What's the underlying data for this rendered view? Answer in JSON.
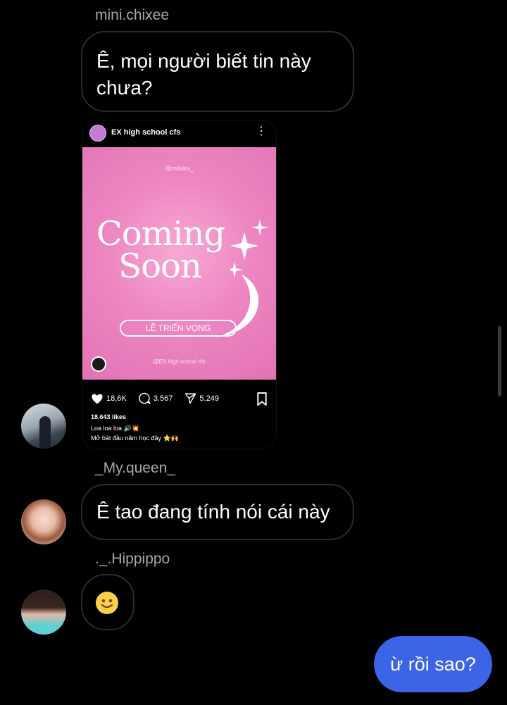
{
  "messages": [
    {
      "sender": "mini.chixee",
      "text": "Ê, mọi người biết tin này chưa?"
    },
    {
      "sender": "_My.queen_",
      "text": "Ê tao đang tính nói cái này"
    },
    {
      "sender": "._.Hippippo",
      "emoji": "slightly-smiling-face"
    }
  ],
  "shared_post": {
    "account": "EX high school cfs",
    "top_watermark": "@miluka_",
    "headline_line1": "Coming",
    "headline_line2": "Soon",
    "event_label": "LỄ TRIỂN VỌNG",
    "bottom_watermark": "@EX high school cfs",
    "likes_count": "18,6K",
    "comments_count": "3.567",
    "shares_count": "5.249",
    "likes_text": "18.643 likes",
    "caption_line1": "Loa loa loa 🔊💥",
    "caption_line2": "Mở bát đầu năm học đây ⭐🙌",
    "image_colors": {
      "light": "#f7a9d4",
      "mid": "#ee86c2",
      "dark": "#e173b5"
    }
  },
  "my_reply": {
    "text": "ừ rồi sao?",
    "color": "#3b64e6"
  }
}
